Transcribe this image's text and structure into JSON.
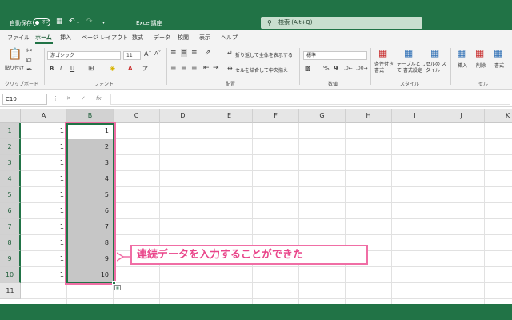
{
  "titlebar": {
    "autosave_label": "自動保存",
    "autosave_state": "オフ",
    "document_title": "Excel講座",
    "search_placeholder": "検索 (Alt+Q)"
  },
  "menu": {
    "tabs": [
      "ファイル",
      "ホーム",
      "挿入",
      "ページ レイアウト",
      "数式",
      "データ",
      "校閲",
      "表示",
      "ヘルプ"
    ],
    "active_tab": "ホーム"
  },
  "ribbon": {
    "paste_label": "貼り付け",
    "clipboard_group": "クリップボード",
    "font_name": "游ゴシック",
    "font_size": "11",
    "font_group": "フォント",
    "wrap_text": "折り返して全体を表示する",
    "merge_center": "セルを結合して中央揃え",
    "alignment_group": "配置",
    "number_format": "標準",
    "number_group": "数値",
    "conditional_format": "条件付き 書式",
    "format_as_table": "テーブルとして 書式設定",
    "cell_styles": "セルの スタイル",
    "styles_group": "スタイル",
    "insert": "挿入",
    "delete": "削除",
    "format": "書式",
    "cells_group": "セル"
  },
  "formula_bar": {
    "name_box": "C10",
    "fx_label": "fx",
    "formula": ""
  },
  "sheet": {
    "columns": [
      "A",
      "B",
      "C",
      "D",
      "E",
      "F",
      "G",
      "H",
      "I",
      "J",
      "K"
    ],
    "rows": [
      "1",
      "2",
      "3",
      "4",
      "5",
      "6",
      "7",
      "8",
      "9",
      "10",
      "11"
    ],
    "col_a_values": [
      "1",
      "1",
      "1",
      "1",
      "1",
      "1",
      "1",
      "1",
      "1",
      "1"
    ],
    "col_b_values": [
      "1",
      "2",
      "3",
      "4",
      "5",
      "6",
      "7",
      "8",
      "9",
      "10"
    ]
  },
  "annotation": {
    "text": "連続データを入力することができた"
  },
  "colors": {
    "excel_green": "#217346",
    "highlight_pink": "#f06ea5",
    "callout_text": "#e9458a",
    "selection_gray": "#c6c6c6"
  }
}
